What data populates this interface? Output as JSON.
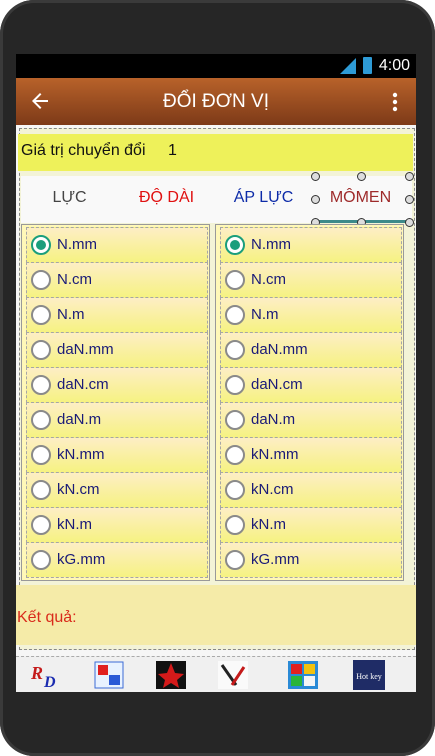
{
  "status": {
    "time": "4:00"
  },
  "appbar": {
    "title": "ĐỔI ĐƠN VỊ"
  },
  "input": {
    "label": "Giá trị chuyển đổi",
    "value": "1"
  },
  "tabs": [
    {
      "label": "LỰC",
      "color": "#444444"
    },
    {
      "label": "ĐỘ DÀI",
      "color": "#e01010"
    },
    {
      "label": "ÁP LỰC",
      "color": "#0d2ba8"
    },
    {
      "label": "MÔMEN",
      "color": "#9e2a2a"
    }
  ],
  "units_from": [
    "N.mm",
    "N.cm",
    "N.m",
    "daN.mm",
    "daN.cm",
    "daN.m",
    "kN.mm",
    "kN.cm",
    "kN.m",
    "kG.mm"
  ],
  "units_to": [
    "N.mm",
    "N.cm",
    "N.m",
    "daN.mm",
    "daN.cm",
    "daN.m",
    "kN.mm",
    "kN.cm",
    "kN.m",
    "kG.mm"
  ],
  "selected_from": 0,
  "selected_to": 0,
  "result": {
    "label": "Kết quả:"
  },
  "ads": [
    {
      "name": "rd-logo"
    },
    {
      "name": "app-logo-2"
    },
    {
      "name": "app-logo-3"
    },
    {
      "name": "app-logo-4"
    },
    {
      "name": "app-logo-5"
    },
    {
      "name": "hot-key-logo",
      "text": "Hot key"
    }
  ]
}
